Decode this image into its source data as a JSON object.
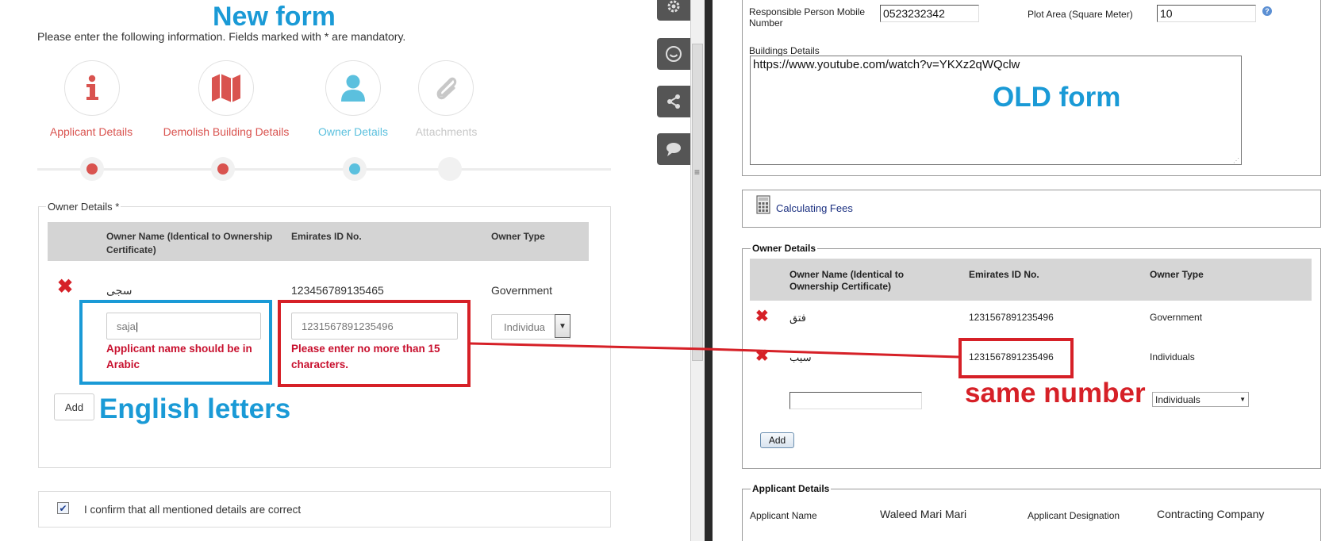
{
  "new_form": {
    "annotation_title": "New form",
    "intro": "Please enter the following information. Fields marked with * are mandatory.",
    "steps": [
      {
        "label": "Applicant Details",
        "icon": "info-icon",
        "color": "#d9534f"
      },
      {
        "label": "Demolish Building Details",
        "icon": "map-icon",
        "color": "#d9534f"
      },
      {
        "label": "Owner Details",
        "icon": "user-icon",
        "color": "#5bc0de"
      },
      {
        "label": "Attachments",
        "icon": "paperclip-icon",
        "color": "#c8c8c8"
      }
    ],
    "owner_section": {
      "legend": "Owner Details *",
      "columns": [
        "Owner Name (Identical to Ownership Certificate)",
        "Emirates ID No.",
        "Owner Type"
      ],
      "row": {
        "name": "سجى",
        "emirates_id": "123456789135465",
        "owner_type": "Government"
      },
      "inputs": {
        "name_value": "saja",
        "emirates_id_value": "1231567891235496",
        "owner_type_value": "Individua"
      },
      "errors": {
        "name": "Applicant name should be in Arabic",
        "emirates_id": "Please enter no more than 15 characters."
      },
      "add_label": "Add"
    },
    "confirm_label": "I confirm that all mentioned details are correct",
    "confirm_checked": true,
    "annotation_english": "English letters"
  },
  "old_form": {
    "annotation_title": "OLD form",
    "mobile_label": "Responsible Person Mobile Number",
    "mobile_value": "0523232342",
    "plot_label": "Plot Area (Square Meter)",
    "plot_value": "10",
    "buildings_label": "Buildings Details",
    "buildings_value": "https://www.youtube.com/watch?v=YKXz2qWQclw",
    "fees_label": "Calculating Fees",
    "owner_section": {
      "legend": "Owner Details",
      "columns": [
        "Owner Name (Identical to Ownership Certificate)",
        "Emirates ID No.",
        "Owner Type"
      ],
      "rows": [
        {
          "name": "فتق",
          "emirates_id": "1231567891235496",
          "owner_type": "Government"
        },
        {
          "name": "سيب",
          "emirates_id": "1231567891235496",
          "owner_type": "Individuals"
        }
      ],
      "select_value": "Individuals",
      "add_label": "Add"
    },
    "applicant_section": {
      "legend": "Applicant Details",
      "name_label": "Applicant Name",
      "name_value": "Waleed Mari Mari",
      "designation_label": "Applicant Designation",
      "designation_value": "Contracting Company"
    },
    "annotation_same": "same number"
  },
  "colors": {
    "annotation_blue": "#1a9ad6",
    "annotation_red": "#d62027",
    "step_red": "#d9534f",
    "step_blue": "#5bc0de"
  }
}
